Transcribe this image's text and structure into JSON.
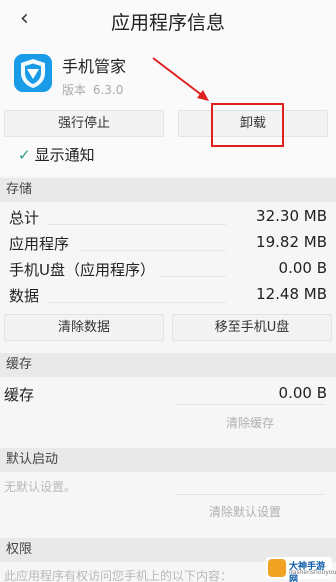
{
  "header": {
    "back_glyph": "‹",
    "title": "应用程序信息"
  },
  "app": {
    "name": "手机管家",
    "version_label": "版本",
    "version": "6.3.0",
    "icon": "tencent-shield-icon",
    "icon_color": "#1a9be8"
  },
  "actions": {
    "force_stop": "强行停止",
    "uninstall": "卸载"
  },
  "notify": {
    "checked": true,
    "label": "显示通知"
  },
  "storage": {
    "header": "存储",
    "rows": [
      {
        "label": "总计",
        "value": "32.30 MB"
      },
      {
        "label": "应用程序",
        "value": "19.82 MB"
      },
      {
        "label": "手机U盘（应用程序）",
        "value": "0.00 B"
      },
      {
        "label": "数据",
        "value": "12.48 MB"
      }
    ],
    "clear_data": "清除数据",
    "move_to_u": "移至手机U盘"
  },
  "cache": {
    "header": "缓存",
    "label": "缓存",
    "value": "0.00 B",
    "clear_cache": "清除缓存"
  },
  "default_launch": {
    "header": "默认启动",
    "text": "无默认设置。",
    "clear_defaults": "清除默认设置"
  },
  "permissions": {
    "header": "权限",
    "text": "此应用程序有权访问您手机上的以下内容："
  },
  "colors": {
    "accent": "#2a9e8e",
    "highlight": "#e02020"
  },
  "watermark": {
    "title": "大神手游网",
    "sub": "dashenshouyou"
  }
}
